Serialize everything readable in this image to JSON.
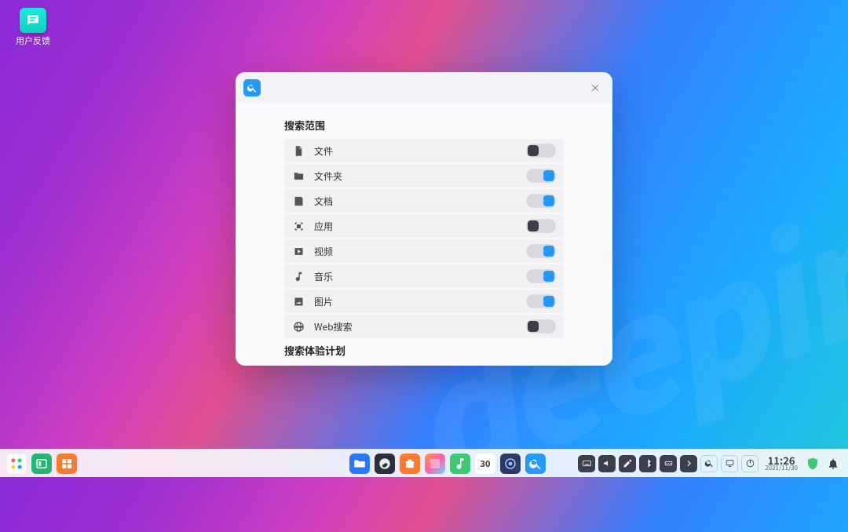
{
  "desktop": {
    "feedback_label": "用户反馈"
  },
  "panel": {
    "section_title": "搜索范围",
    "section_title2": "搜索体验计划",
    "items": [
      {
        "label": "文件",
        "on": false
      },
      {
        "label": "文件夹",
        "on": true
      },
      {
        "label": "文档",
        "on": true
      },
      {
        "label": "应用",
        "on": false
      },
      {
        "label": "视频",
        "on": true
      },
      {
        "label": "音乐",
        "on": true
      },
      {
        "label": "图片",
        "on": true
      },
      {
        "label": "Web搜索",
        "on": false
      }
    ]
  },
  "dock": {
    "calendar_day": "30"
  },
  "clock": {
    "time": "11:26",
    "date": "2021/11/30"
  },
  "watermark": "deepin"
}
